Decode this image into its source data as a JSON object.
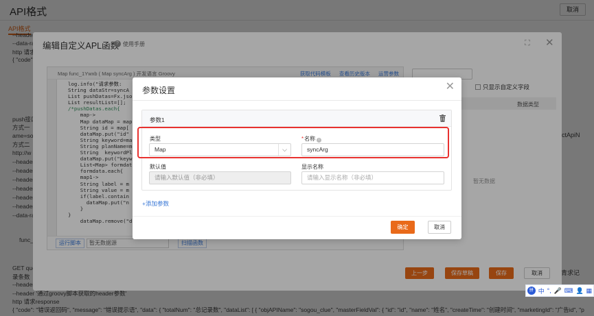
{
  "page": {
    "title": "API格式",
    "cancel": "取消",
    "tab": "API格式",
    "bg_lines": [
      "--header",
      "--data-ra",
      "http 请求",
      "{ \"code\"",
      "push接口",
      "方式一",
      "ame=so",
      "方式二",
      "http://w",
      "--header",
      "--header",
      "--header",
      "--header",
      "--header",
      "--header",
      "--data-ra",
      "func_",
      "GET que",
      "录条数",
      "--header 'Content-Type: application/json'",
      "--header '通过groovy脚本获取的header参数'",
      "http 请求response",
      "{ \"code\": \"错误返回码\", \"message\": \"错误提示语\", \"data\": { \"totalNum\": \"总记录数\", \"dataList\": [ { \"objAPIName\": \"sogou_clue\", \"masterFieldVal\": { \"id\": \"id\", \"name\": \"姓名\", \"createTime\": \"创建时间\", \"marketingId\": \"广告id\", \"p"
    ],
    "bg_right_frag": "ctApiN",
    "bg_right_frag2": "青求记"
  },
  "outer_modal": {
    "title": "编辑自定义APL函数",
    "help": "使用手册",
    "help_icon": "?",
    "expand_icon": "⛶",
    "close_icon": "✕",
    "editor_header": "Map func_1Ywxb ( Map syncArg )   开发语言 Groovy",
    "editor_links": [
      "获取代码模板",
      "查看历史版本",
      "运营参数"
    ],
    "code_lines": [
      "log.info(\"请求参数:",
      "String dataStr=syncA",
      "List pushDatas=Fx.jso",
      "List resultList=[];",
      "/*pushDatas.each{",
      "    map->",
      "    Map dataMap = map",
      "    String id = map[",
      "    dataMap.put(\"id\"",
      "    String keyword=ma",
      "    String planName=m",
      "    String  keywordPl",
      "    dataMap.put(\"keyw",
      "    List<Map> formdat",
      "    formdata.each{",
      "    map1->",
      "    String label = m",
      "    String value = m",
      "    if(label.contain",
      "      dataMap.put(\"n",
      "    }",
      "}",
      "    dataMap.remove(\"d"
    ],
    "run_btn": "运行脚本",
    "ds_select": "暂无数据源",
    "format_btn": "扫描函数",
    "rp_check": "只显示自定义字段",
    "rp_th": "数据类型",
    "rp_empty": "暂无数据",
    "footer": {
      "prev": "上一步",
      "save2": "保存草稿",
      "save": "保存",
      "cancel": "取消"
    }
  },
  "dialog": {
    "title": "参数设置",
    "close_icon": "✕",
    "param_label": "参数1",
    "type_label": "类型",
    "type_value": "Map",
    "chevron": "⌵",
    "name_label": "名称",
    "name_value": "syncArg",
    "info_icon": "i",
    "default_label": "默认值",
    "default_placeholder": "请输入默认值（非必填）",
    "display_label": "显示名称",
    "display_placeholder": "请输入显示名称（非必填）",
    "add_param": "+添加参数",
    "ok": "确定",
    "cancel": "取消"
  },
  "ime": {
    "logo": "拼",
    "items": [
      "中",
      "°,",
      "🎤",
      "⌨",
      "👤",
      "▦"
    ]
  },
  "colors": {
    "accent": "#e96a1a",
    "highlight": "#e8312f",
    "link": "#3a78d6"
  }
}
